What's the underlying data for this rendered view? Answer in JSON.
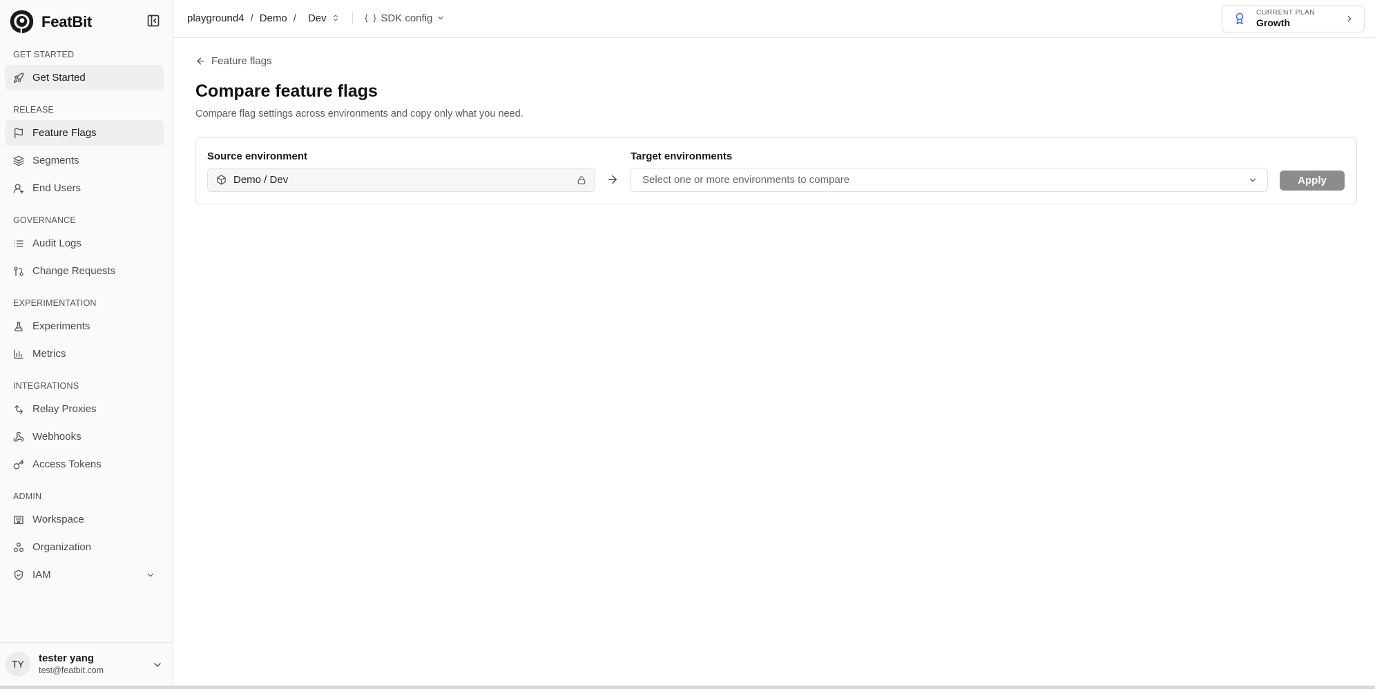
{
  "app": {
    "name": "FeatBit"
  },
  "sidebar": {
    "sections": [
      {
        "title": "GET STARTED",
        "items": [
          {
            "label": "Get Started",
            "icon": "rocket-icon"
          }
        ]
      },
      {
        "title": "RELEASE",
        "items": [
          {
            "label": "Feature Flags",
            "icon": "flag-icon",
            "active": true
          },
          {
            "label": "Segments",
            "icon": "layers-icon"
          },
          {
            "label": "End Users",
            "icon": "user-icon"
          }
        ]
      },
      {
        "title": "GOVERNANCE",
        "items": [
          {
            "label": "Audit Logs",
            "icon": "list-icon"
          },
          {
            "label": "Change Requests",
            "icon": "git-pull-request-icon"
          }
        ]
      },
      {
        "title": "EXPERIMENTATION",
        "items": [
          {
            "label": "Experiments",
            "icon": "flask-icon"
          },
          {
            "label": "Metrics",
            "icon": "bar-chart-icon"
          }
        ]
      },
      {
        "title": "INTEGRATIONS",
        "items": [
          {
            "label": "Relay Proxies",
            "icon": "relay-icon"
          },
          {
            "label": "Webhooks",
            "icon": "webhook-icon"
          },
          {
            "label": "Access Tokens",
            "icon": "key-icon"
          }
        ]
      },
      {
        "title": "ADMIN",
        "items": [
          {
            "label": "Workspace",
            "icon": "building-icon"
          },
          {
            "label": "Organization",
            "icon": "organization-icon"
          },
          {
            "label": "IAM",
            "icon": "shield-icon",
            "expandable": true
          }
        ]
      }
    ],
    "user": {
      "initials": "TY",
      "name": "tester yang",
      "email": "test@featbit.com"
    }
  },
  "topbar": {
    "breadcrumb": {
      "workspace": "playground4",
      "project": "Demo",
      "environment": "Dev"
    },
    "sdk_config": "SDK config",
    "plan": {
      "label": "CURRENT PLAN",
      "value": "Growth"
    }
  },
  "main": {
    "back_link": "Feature flags",
    "title": "Compare feature flags",
    "subtitle": "Compare flag settings across environments and copy only what you need.",
    "source": {
      "label": "Source environment",
      "value": "Demo / Dev"
    },
    "target": {
      "label": "Target environments",
      "placeholder": "Select one or more environments to compare"
    },
    "apply_label": "Apply"
  },
  "colors": {
    "accent_blue": "#2f6bf0",
    "apply_disabled": "#8c8c8c",
    "active_nav_bg": "#efefef"
  }
}
